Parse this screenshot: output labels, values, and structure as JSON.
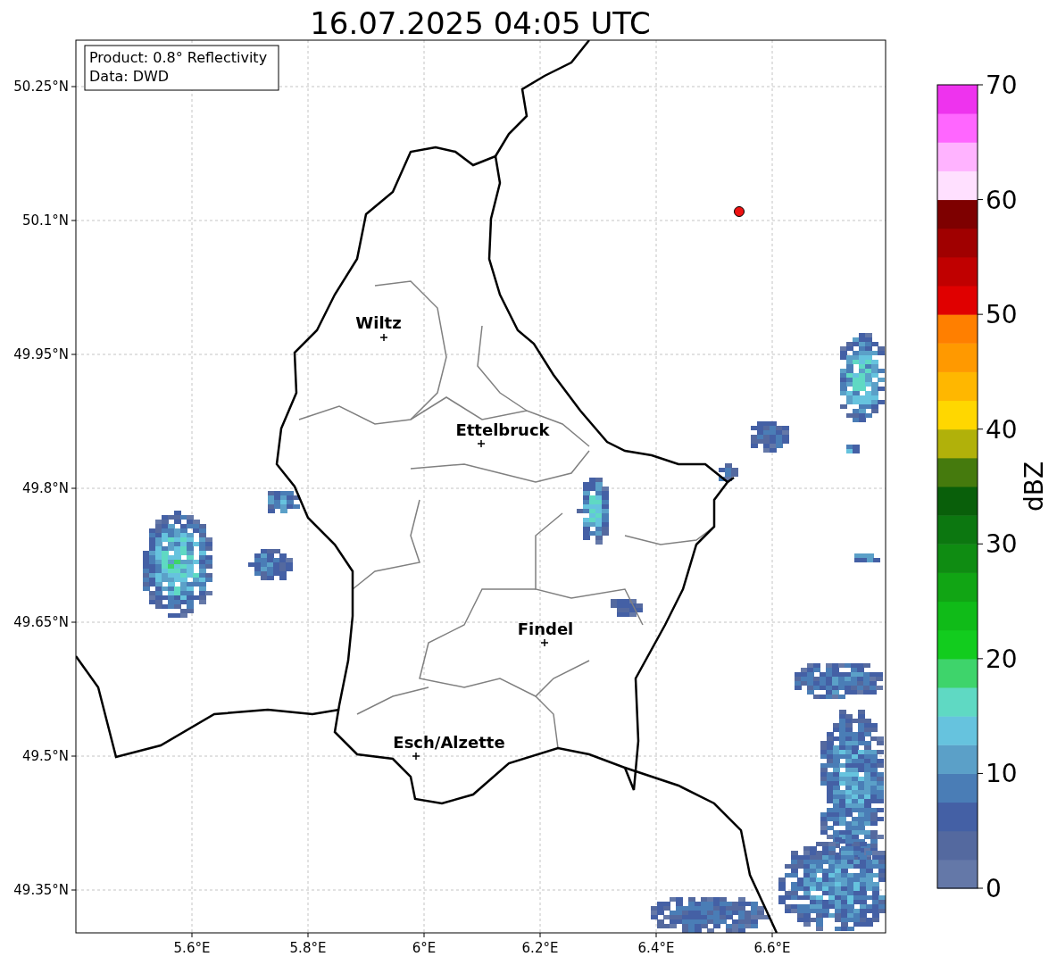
{
  "title": "16.07.2025 04:05 UTC",
  "legend": [
    "Product: 0.8° Reflectivity",
    "Data: DWD"
  ],
  "x_ticks": [
    "5.6°E",
    "5.8°E",
    "6°E",
    "6.2°E",
    "6.4°E",
    "6.6°E"
  ],
  "y_ticks": [
    "50.25°N",
    "50.1°N",
    "49.95°N",
    "49.8°N",
    "49.65°N",
    "49.5°N",
    "49.35°N"
  ],
  "cities": [
    {
      "name": "Wiltz"
    },
    {
      "name": "Ettelbruck"
    },
    {
      "name": "Findel"
    },
    {
      "name": "Esch/Alzette"
    }
  ],
  "colorbar": {
    "label": "dBZ",
    "ticks": [
      "70",
      "60",
      "50",
      "40",
      "30",
      "20",
      "10",
      "0"
    ],
    "bins": [
      {
        "color": "#6478a8"
      },
      {
        "color": "#54699f"
      },
      {
        "color": "#4460a5"
      },
      {
        "color": "#4a7db6"
      },
      {
        "color": "#5ba0c8"
      },
      {
        "color": "#66c3de"
      },
      {
        "color": "#5fd9c3"
      },
      {
        "color": "#3ed46b"
      },
      {
        "color": "#12cc1e"
      },
      {
        "color": "#10bb18"
      },
      {
        "color": "#11a514"
      },
      {
        "color": "#0f8c12"
      },
      {
        "color": "#0c7710"
      },
      {
        "color": "#095f0a"
      },
      {
        "color": "#457a0d"
      },
      {
        "color": "#b1b10a"
      },
      {
        "color": "#ffd700"
      },
      {
        "color": "#ffb700"
      },
      {
        "color": "#ff9900"
      },
      {
        "color": "#ff7f00"
      },
      {
        "color": "#e00000"
      },
      {
        "color": "#c00000"
      },
      {
        "color": "#a00000"
      },
      {
        "color": "#7e0000"
      },
      {
        "color": "#ffe0ff"
      },
      {
        "color": "#ffb3ff"
      },
      {
        "color": "#ff66ff"
      },
      {
        "color": "#ee33ee"
      }
    ]
  }
}
